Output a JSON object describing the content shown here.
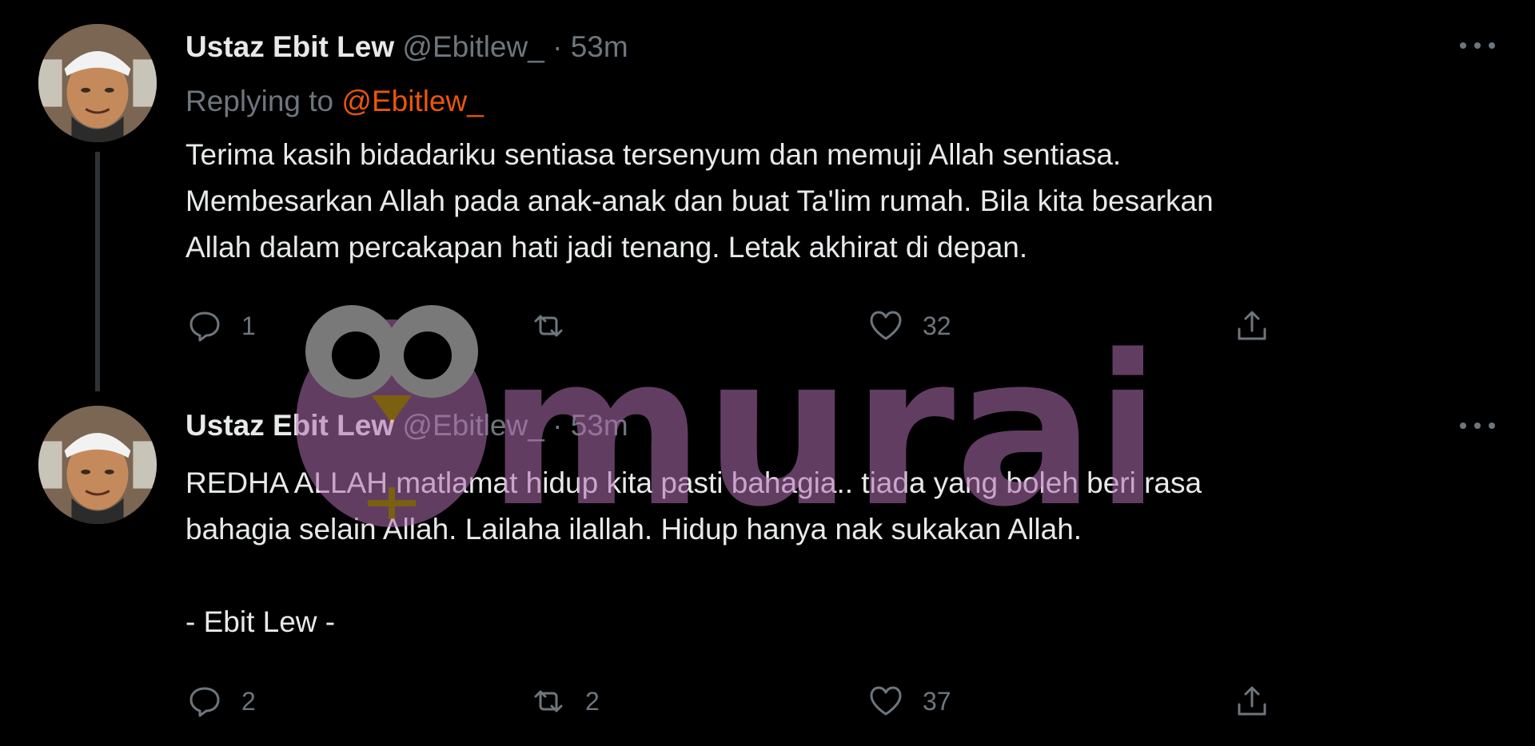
{
  "tweets": [
    {
      "name": "Ustaz Ebit Lew",
      "handle": "@Ebitlew_",
      "separator": "·",
      "time": "53m",
      "replying_prefix": "Replying to",
      "replying_to": "@Ebitlew_",
      "text_lines": [
        "Terima kasih bidadariku sentiasa tersenyum dan memuji Allah sentiasa.",
        "Membesarkan Allah pada anak-anak dan buat Ta'lim rumah. Bila kita besarkan",
        "Allah dalam percakapan hati jadi tenang. Letak akhirat di depan."
      ],
      "replies": "1",
      "retweets": "",
      "likes": "32"
    },
    {
      "name": "Ustaz Ebit Lew",
      "handle": "@Ebitlew_",
      "separator": "·",
      "time": "53m",
      "text_lines": [
        "REDHA ALLAH matlamat hidup kita pasti bahagia.. tiada yang boleh beri rasa",
        "bahagia selain Allah. Lailaha ilallah. Hidup hanya nak sukakan Allah.",
        "",
        "- Ebit Lew -"
      ],
      "replies": "2",
      "retweets": "2",
      "likes": "37"
    }
  ],
  "watermark": {
    "text": "murai",
    "color": "#b36fb3"
  },
  "icons": [
    "more-icon",
    "reply-icon",
    "retweet-icon",
    "like-icon",
    "share-icon"
  ]
}
